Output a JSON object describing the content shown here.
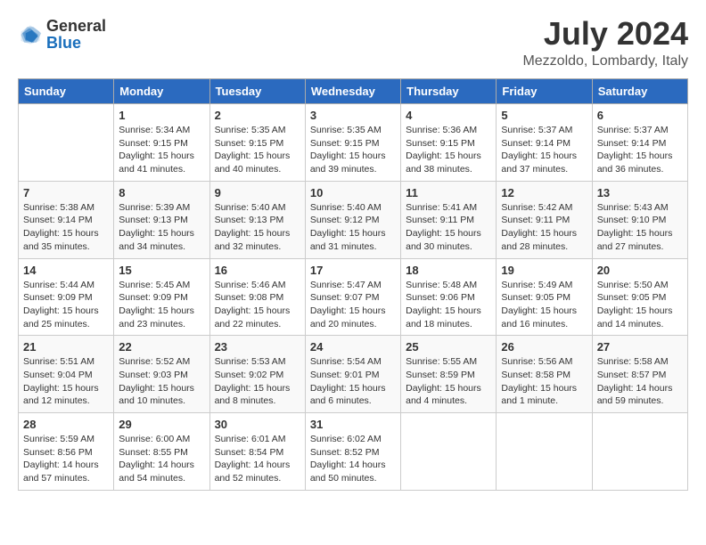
{
  "header": {
    "logo_general": "General",
    "logo_blue": "Blue",
    "title": "July 2024",
    "subtitle": "Mezzoldo, Lombardy, Italy"
  },
  "calendar": {
    "days_of_week": [
      "Sunday",
      "Monday",
      "Tuesday",
      "Wednesday",
      "Thursday",
      "Friday",
      "Saturday"
    ],
    "weeks": [
      [
        {
          "day": "",
          "info": ""
        },
        {
          "day": "1",
          "info": "Sunrise: 5:34 AM\nSunset: 9:15 PM\nDaylight: 15 hours\nand 41 minutes."
        },
        {
          "day": "2",
          "info": "Sunrise: 5:35 AM\nSunset: 9:15 PM\nDaylight: 15 hours\nand 40 minutes."
        },
        {
          "day": "3",
          "info": "Sunrise: 5:35 AM\nSunset: 9:15 PM\nDaylight: 15 hours\nand 39 minutes."
        },
        {
          "day": "4",
          "info": "Sunrise: 5:36 AM\nSunset: 9:15 PM\nDaylight: 15 hours\nand 38 minutes."
        },
        {
          "day": "5",
          "info": "Sunrise: 5:37 AM\nSunset: 9:14 PM\nDaylight: 15 hours\nand 37 minutes."
        },
        {
          "day": "6",
          "info": "Sunrise: 5:37 AM\nSunset: 9:14 PM\nDaylight: 15 hours\nand 36 minutes."
        }
      ],
      [
        {
          "day": "7",
          "info": "Sunrise: 5:38 AM\nSunset: 9:14 PM\nDaylight: 15 hours\nand 35 minutes."
        },
        {
          "day": "8",
          "info": "Sunrise: 5:39 AM\nSunset: 9:13 PM\nDaylight: 15 hours\nand 34 minutes."
        },
        {
          "day": "9",
          "info": "Sunrise: 5:40 AM\nSunset: 9:13 PM\nDaylight: 15 hours\nand 32 minutes."
        },
        {
          "day": "10",
          "info": "Sunrise: 5:40 AM\nSunset: 9:12 PM\nDaylight: 15 hours\nand 31 minutes."
        },
        {
          "day": "11",
          "info": "Sunrise: 5:41 AM\nSunset: 9:11 PM\nDaylight: 15 hours\nand 30 minutes."
        },
        {
          "day": "12",
          "info": "Sunrise: 5:42 AM\nSunset: 9:11 PM\nDaylight: 15 hours\nand 28 minutes."
        },
        {
          "day": "13",
          "info": "Sunrise: 5:43 AM\nSunset: 9:10 PM\nDaylight: 15 hours\nand 27 minutes."
        }
      ],
      [
        {
          "day": "14",
          "info": "Sunrise: 5:44 AM\nSunset: 9:09 PM\nDaylight: 15 hours\nand 25 minutes."
        },
        {
          "day": "15",
          "info": "Sunrise: 5:45 AM\nSunset: 9:09 PM\nDaylight: 15 hours\nand 23 minutes."
        },
        {
          "day": "16",
          "info": "Sunrise: 5:46 AM\nSunset: 9:08 PM\nDaylight: 15 hours\nand 22 minutes."
        },
        {
          "day": "17",
          "info": "Sunrise: 5:47 AM\nSunset: 9:07 PM\nDaylight: 15 hours\nand 20 minutes."
        },
        {
          "day": "18",
          "info": "Sunrise: 5:48 AM\nSunset: 9:06 PM\nDaylight: 15 hours\nand 18 minutes."
        },
        {
          "day": "19",
          "info": "Sunrise: 5:49 AM\nSunset: 9:05 PM\nDaylight: 15 hours\nand 16 minutes."
        },
        {
          "day": "20",
          "info": "Sunrise: 5:50 AM\nSunset: 9:05 PM\nDaylight: 15 hours\nand 14 minutes."
        }
      ],
      [
        {
          "day": "21",
          "info": "Sunrise: 5:51 AM\nSunset: 9:04 PM\nDaylight: 15 hours\nand 12 minutes."
        },
        {
          "day": "22",
          "info": "Sunrise: 5:52 AM\nSunset: 9:03 PM\nDaylight: 15 hours\nand 10 minutes."
        },
        {
          "day": "23",
          "info": "Sunrise: 5:53 AM\nSunset: 9:02 PM\nDaylight: 15 hours\nand 8 minutes."
        },
        {
          "day": "24",
          "info": "Sunrise: 5:54 AM\nSunset: 9:01 PM\nDaylight: 15 hours\nand 6 minutes."
        },
        {
          "day": "25",
          "info": "Sunrise: 5:55 AM\nSunset: 8:59 PM\nDaylight: 15 hours\nand 4 minutes."
        },
        {
          "day": "26",
          "info": "Sunrise: 5:56 AM\nSunset: 8:58 PM\nDaylight: 15 hours\nand 1 minute."
        },
        {
          "day": "27",
          "info": "Sunrise: 5:58 AM\nSunset: 8:57 PM\nDaylight: 14 hours\nand 59 minutes."
        }
      ],
      [
        {
          "day": "28",
          "info": "Sunrise: 5:59 AM\nSunset: 8:56 PM\nDaylight: 14 hours\nand 57 minutes."
        },
        {
          "day": "29",
          "info": "Sunrise: 6:00 AM\nSunset: 8:55 PM\nDaylight: 14 hours\nand 54 minutes."
        },
        {
          "day": "30",
          "info": "Sunrise: 6:01 AM\nSunset: 8:54 PM\nDaylight: 14 hours\nand 52 minutes."
        },
        {
          "day": "31",
          "info": "Sunrise: 6:02 AM\nSunset: 8:52 PM\nDaylight: 14 hours\nand 50 minutes."
        },
        {
          "day": "",
          "info": ""
        },
        {
          "day": "",
          "info": ""
        },
        {
          "day": "",
          "info": ""
        }
      ]
    ]
  }
}
